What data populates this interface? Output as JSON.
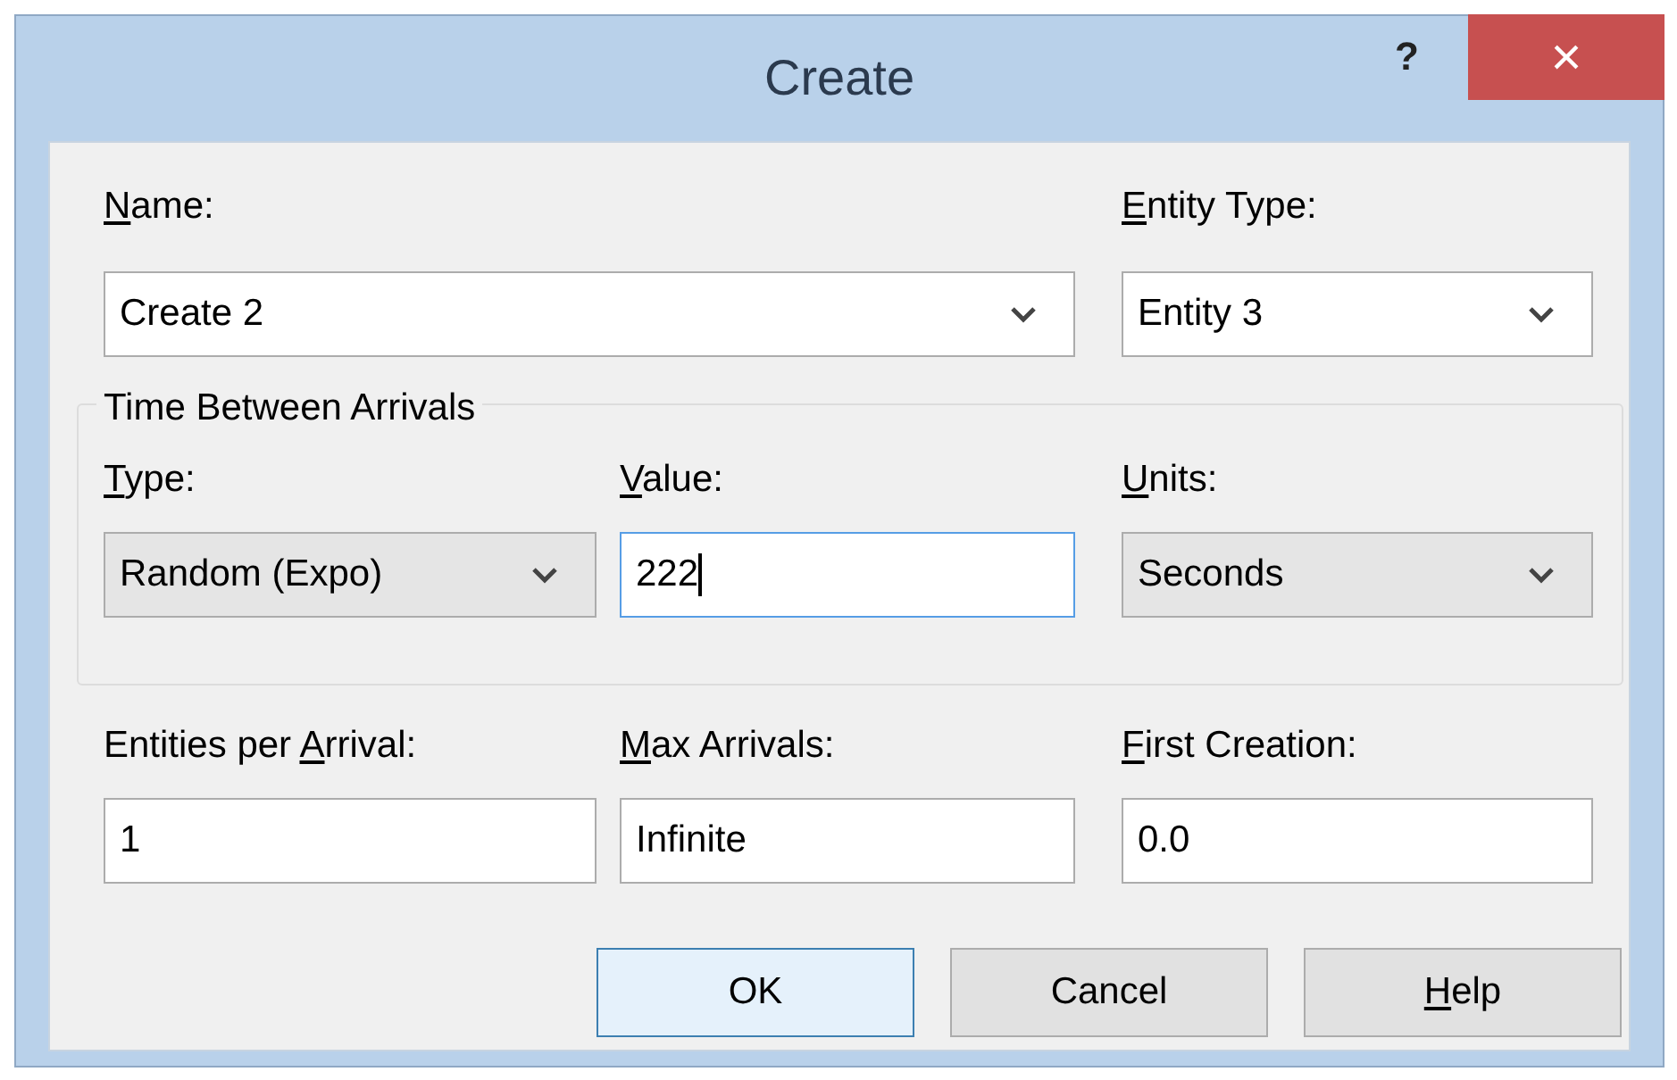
{
  "window": {
    "title": "Create",
    "help_glyph": "?",
    "close_glyph": "×"
  },
  "name": {
    "label": {
      "key": "N",
      "post": "ame:"
    },
    "field": {
      "kind": "combo",
      "value": "Create 2",
      "focused": false
    }
  },
  "entity_type": {
    "label": {
      "key": "E",
      "post": "ntity Type:"
    },
    "field": {
      "kind": "combo",
      "value": "Entity 3",
      "focused": false
    }
  },
  "time_between_arrivals": {
    "title": "Time Between Arrivals",
    "fields": [
      {
        "label": {
          "key": "T",
          "post": "ype:"
        },
        "kind": "dropdown",
        "value": "Random (Expo)",
        "focused": false
      },
      {
        "label": {
          "key": "V",
          "post": "alue:"
        },
        "kind": "text",
        "value": "222",
        "focused": true
      },
      {
        "label": {
          "key": "U",
          "post": "nits:"
        },
        "kind": "dropdown",
        "value": "Seconds",
        "focused": false
      }
    ]
  },
  "fields": [
    {
      "label": {
        "pre": "Entities per ",
        "key": "A",
        "post": "rrival:"
      },
      "kind": "text",
      "value": "1",
      "focused": false
    },
    {
      "label": {
        "key": "M",
        "post": "ax Arrivals:"
      },
      "kind": "text",
      "value": "Infinite",
      "focused": false
    },
    {
      "label": {
        "key": "F",
        "post": "irst Creation:"
      },
      "kind": "text",
      "value": "0.0",
      "focused": false
    }
  ],
  "buttons": [
    {
      "label": {
        "pre": "OK"
      },
      "default": true
    },
    {
      "label": {
        "pre": "Cancel"
      },
      "default": false
    },
    {
      "label": {
        "key": "H",
        "post": "elp"
      },
      "default": false
    }
  ]
}
